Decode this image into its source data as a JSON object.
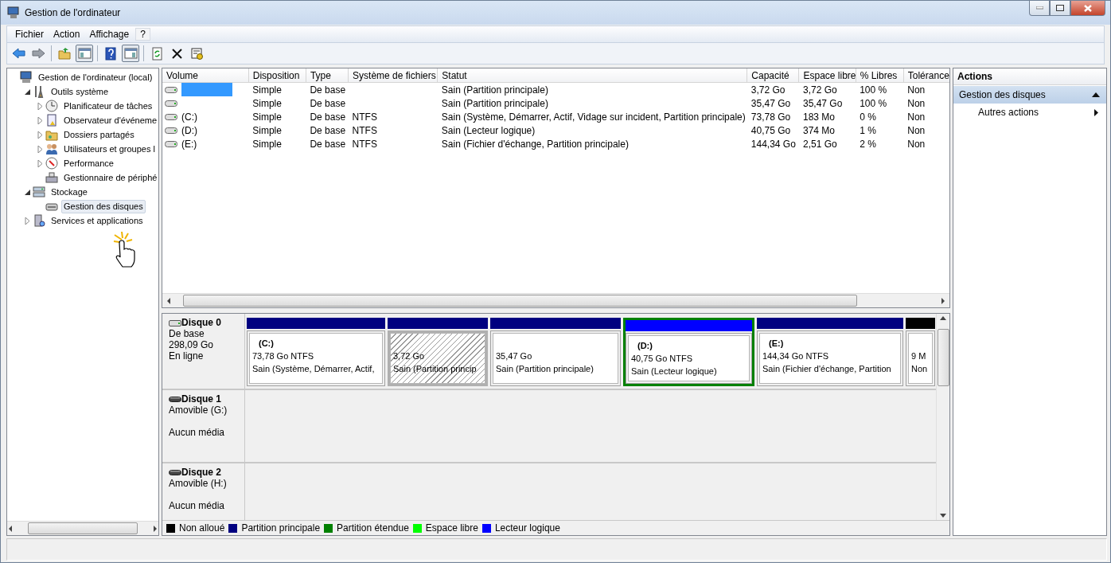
{
  "window": {
    "title": "Gestion de l'ordinateur"
  },
  "menu": [
    {
      "label": "Fichier",
      "highlighted": false
    },
    {
      "label": "Action",
      "highlighted": false
    },
    {
      "label": "Affichage",
      "highlighted": false
    },
    {
      "label": "?",
      "highlighted": true
    }
  ],
  "tree": [
    {
      "label": "Gestion de l'ordinateur (local)",
      "selected": false,
      "children": [
        {
          "label": "Outils système",
          "expanded": true,
          "selected": false,
          "children": [
            {
              "label": "Planificateur de tâches",
              "expanded": false,
              "selected": false
            },
            {
              "label": "Observateur d'événeme",
              "expanded": false,
              "selected": false
            },
            {
              "label": "Dossiers partagés",
              "expanded": false,
              "selected": false
            },
            {
              "label": "Utilisateurs et groupes l",
              "expanded": false,
              "selected": false
            },
            {
              "label": "Performance",
              "expanded": false,
              "selected": false
            },
            {
              "label": "Gestionnaire de périphé",
              "selected": false
            }
          ]
        },
        {
          "label": "Stockage",
          "expanded": true,
          "selected": false,
          "children": [
            {
              "label": "Gestion des disques",
              "selected": true
            }
          ]
        },
        {
          "label": "Services et applications",
          "expanded": false,
          "selected": false
        }
      ]
    }
  ],
  "volume_table": {
    "columns": [
      "Volume",
      "Disposition",
      "Type",
      "Système de fichiers",
      "Statut",
      "Capacité",
      "Espace libre",
      "% Libres",
      "Tolérance"
    ],
    "rows": [
      {
        "selected": true,
        "cells": [
          "",
          "Simple",
          "De base",
          "",
          "Sain (Partition principale)",
          "3,72 Go",
          "3,72 Go",
          "100 %",
          "Non"
        ]
      },
      {
        "selected": false,
        "cells": [
          "",
          "Simple",
          "De base",
          "",
          "Sain (Partition principale)",
          "35,47 Go",
          "35,47 Go",
          "100 %",
          "Non"
        ]
      },
      {
        "selected": false,
        "cells": [
          "(C:)",
          "Simple",
          "De base",
          "NTFS",
          "Sain (Système, Démarrer, Actif, Vidage sur incident, Partition principale)",
          "73,78 Go",
          "183 Mo",
          "0 %",
          "Non"
        ]
      },
      {
        "selected": false,
        "cells": [
          "(D:)",
          "Simple",
          "De base",
          "NTFS",
          "Sain (Lecteur logique)",
          "40,75 Go",
          "374 Mo",
          "1 %",
          "Non"
        ]
      },
      {
        "selected": false,
        "cells": [
          "(E:)",
          "Simple",
          "De base",
          "NTFS",
          "Sain (Fichier d'échange, Partition principale)",
          "144,34 Go",
          "2,51 Go",
          "2 %",
          "Non"
        ]
      }
    ]
  },
  "disks": [
    {
      "kind": "basic",
      "name": "Disque 0",
      "type": "De base",
      "size": "298,09 Go",
      "status": "En ligne",
      "partitions": [
        {
          "kind": "primary",
          "label": "(C:)",
          "size": "73,78 Go NTFS",
          "status": "Sain (Système, Démarrer, Actif,",
          "selected": false,
          "extended": false
        },
        {
          "kind": "primary",
          "size": "3,72 Go",
          "status": "Sain (Partition princip",
          "selected": true,
          "extended": false
        },
        {
          "kind": "primary",
          "size": "35,47 Go",
          "status": "Sain (Partition principale)",
          "selected": false,
          "extended": false
        },
        {
          "kind": "logical",
          "label": "(D:)",
          "size": "40,75 Go NTFS",
          "status": "Sain (Lecteur logique)",
          "selected": false,
          "extended": true
        },
        {
          "kind": "primary",
          "label": "(E:)",
          "size": "144,34 Go NTFS",
          "status": "Sain (Fichier d'échange, Partition",
          "selected": false,
          "extended": false
        },
        {
          "kind": "unallocated",
          "size": "9 M",
          "status": "Non",
          "selected": false,
          "extended": false
        }
      ]
    },
    {
      "kind": "removable",
      "name": "Disque 1",
      "type": "Amovible (G:)",
      "status": "Aucun média"
    },
    {
      "kind": "removable",
      "name": "Disque 2",
      "type": "Amovible (H:)",
      "status": "Aucun média"
    }
  ],
  "legend": [
    {
      "kind": "unallocated",
      "label": "Non alloué",
      "color": "#000000"
    },
    {
      "kind": "primary",
      "label": "Partition principale",
      "color": "#000080"
    },
    {
      "kind": "extended",
      "label": "Partition étendue",
      "color": "#008000"
    },
    {
      "kind": "free",
      "label": "Espace libre",
      "color": "#00ff00"
    },
    {
      "kind": "logical",
      "label": "Lecteur logique",
      "color": "#0000ff"
    }
  ],
  "actions": {
    "title": "Actions",
    "sections": [
      {
        "title": "Gestion des disques",
        "expanded": true,
        "items": [
          {
            "label": "Autres actions",
            "has_submenu": true
          }
        ]
      }
    ]
  }
}
